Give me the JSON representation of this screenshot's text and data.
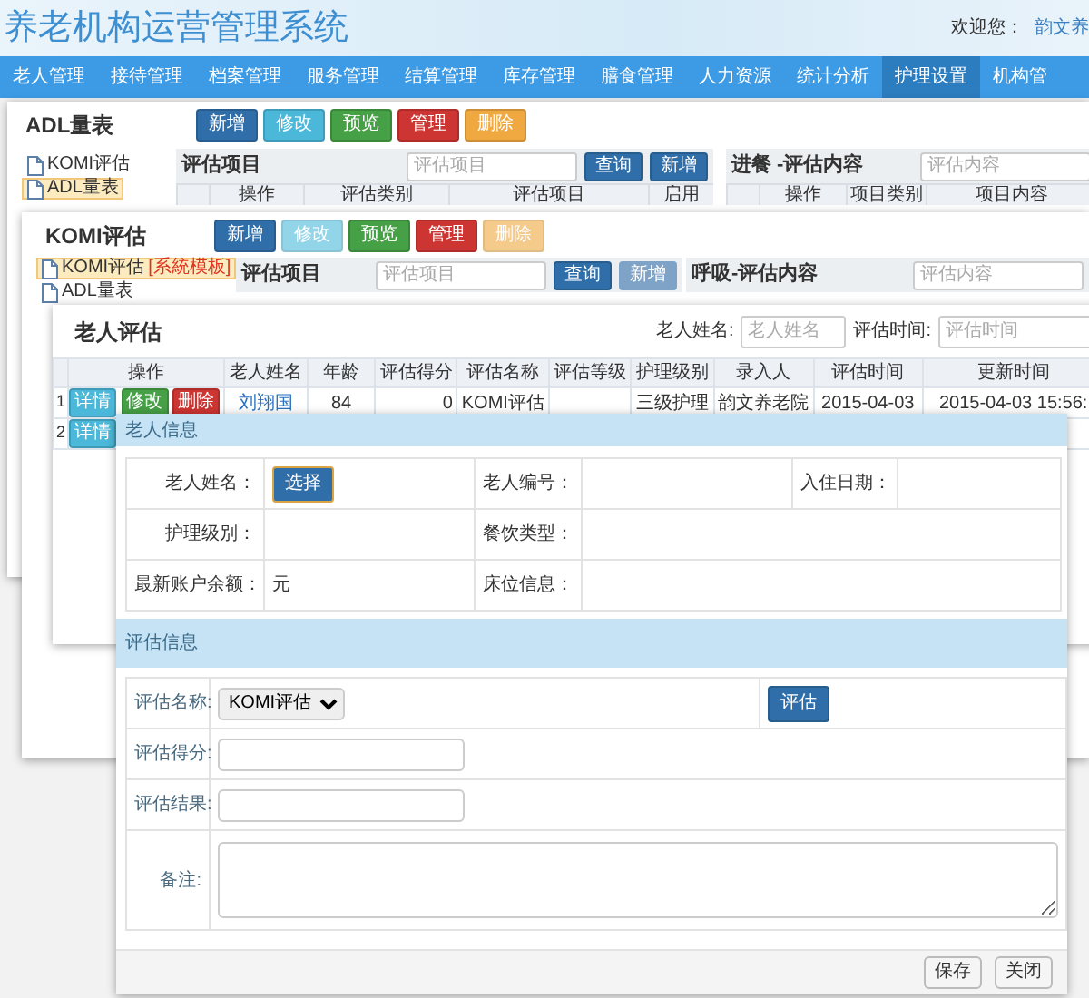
{
  "header": {
    "title": "养老机构运营管理系统",
    "welcome": "欢迎您：",
    "user": "韵文养"
  },
  "nav": [
    {
      "label": "老人管理",
      "selected": false
    },
    {
      "label": "接待管理",
      "selected": false
    },
    {
      "label": "档案管理",
      "selected": false
    },
    {
      "label": "服务管理",
      "selected": false
    },
    {
      "label": "结算管理",
      "selected": false
    },
    {
      "label": "库存管理",
      "selected": false
    },
    {
      "label": "膳食管理",
      "selected": false
    },
    {
      "label": "人力资源",
      "selected": false
    },
    {
      "label": "统计分析",
      "selected": false
    },
    {
      "label": "护理设置",
      "selected": true
    },
    {
      "label": "机构管",
      "selected": false
    }
  ],
  "panels": [
    {
      "title": "ADL量表",
      "toolbar": [
        {
          "label": "新增",
          "kind": "primary",
          "disabled": false
        },
        {
          "label": "修改",
          "kind": "info",
          "disabled": false
        },
        {
          "label": "预览",
          "kind": "success",
          "disabled": false
        },
        {
          "label": "管理",
          "kind": "danger",
          "disabled": false
        },
        {
          "label": "删除",
          "kind": "warning",
          "disabled": false
        }
      ],
      "tree": [
        {
          "label": "KOMI评估",
          "selected": false
        },
        {
          "label": "ADL量表",
          "selected": true
        }
      ],
      "items": {
        "title": "评估项目",
        "placeholder": "评估项目",
        "buttons": [
          {
            "label": "查询",
            "disabled": false
          },
          {
            "label": "新增",
            "disabled": false
          }
        ],
        "columns": [
          "操作",
          "评估类别",
          "评估项目",
          "启用"
        ]
      },
      "content": {
        "title": "进餐 -评估内容",
        "placeholder": "评估内容",
        "columns": [
          "操作",
          "项目类别",
          "项目内容"
        ]
      }
    },
    {
      "title": "KOMI评估",
      "toolbar": [
        {
          "label": "新增",
          "kind": "primary",
          "disabled": false
        },
        {
          "label": "修改",
          "kind": "info",
          "disabled": true
        },
        {
          "label": "预览",
          "kind": "success",
          "disabled": false
        },
        {
          "label": "管理",
          "kind": "danger",
          "disabled": false
        },
        {
          "label": "删除",
          "kind": "warning",
          "disabled": true
        }
      ],
      "tree": [
        {
          "label": "KOMI评估",
          "tag": "[系統模板]",
          "selected": true
        },
        {
          "label": "ADL量表",
          "selected": false
        }
      ],
      "items": {
        "title": "评估项目",
        "placeholder": "评估项目",
        "buttons": [
          {
            "label": "查询",
            "disabled": false
          },
          {
            "label": "新增",
            "disabled": true
          }
        ]
      },
      "content": {
        "title": "呼吸-评估内容",
        "placeholder": "评估内容"
      }
    }
  ],
  "assessments": {
    "title": "老人评估",
    "filters": [
      {
        "label": "老人姓名:",
        "placeholder": "老人姓名"
      },
      {
        "label": "评估时间:",
        "placeholder": "评估时间"
      }
    ],
    "columns": [
      "操作",
      "老人姓名",
      "年龄",
      "评估得分",
      "评估名称",
      "评估等级",
      "护理级别",
      "录入人",
      "评估时间",
      "更新时间"
    ],
    "rows": [
      {
        "index": "1",
        "actions": [
          {
            "label": "详情",
            "kind": "info"
          },
          {
            "label": "修改",
            "kind": "success"
          },
          {
            "label": "删除",
            "kind": "danger"
          }
        ],
        "name": "刘翔国",
        "age": "84",
        "score": "0",
        "assessment": "KOMI评估",
        "care_level": "三级护理",
        "entered_by": "韵文养老院",
        "assessed_at": "2015-04-03",
        "updated_at": "2015-04-03 15:56:"
      },
      {
        "index": "2",
        "actions": [
          {
            "label": "详情",
            "kind": "info"
          }
        ]
      }
    ]
  },
  "dialog": {
    "elder_info": {
      "title": "老人信息",
      "name_label": "老人姓名：",
      "select_button": "选择",
      "number_label": "老人编号：",
      "admission_label": "入住日期：",
      "care_label": "护理级别：",
      "meal_label": "餐饮类型：",
      "balance_label": "最新账户余额：",
      "balance_unit": "元",
      "bed_label": "床位信息："
    },
    "assessment_info": {
      "title": "评估信息",
      "name_label": "评估名称:",
      "name_value": "KOMI评估",
      "evaluate_button": "评估",
      "score_label": "评估得分:",
      "result_label": "评估结果:",
      "remark_label": "备注:"
    },
    "footer_buttons": [
      "保存",
      "关闭"
    ]
  }
}
